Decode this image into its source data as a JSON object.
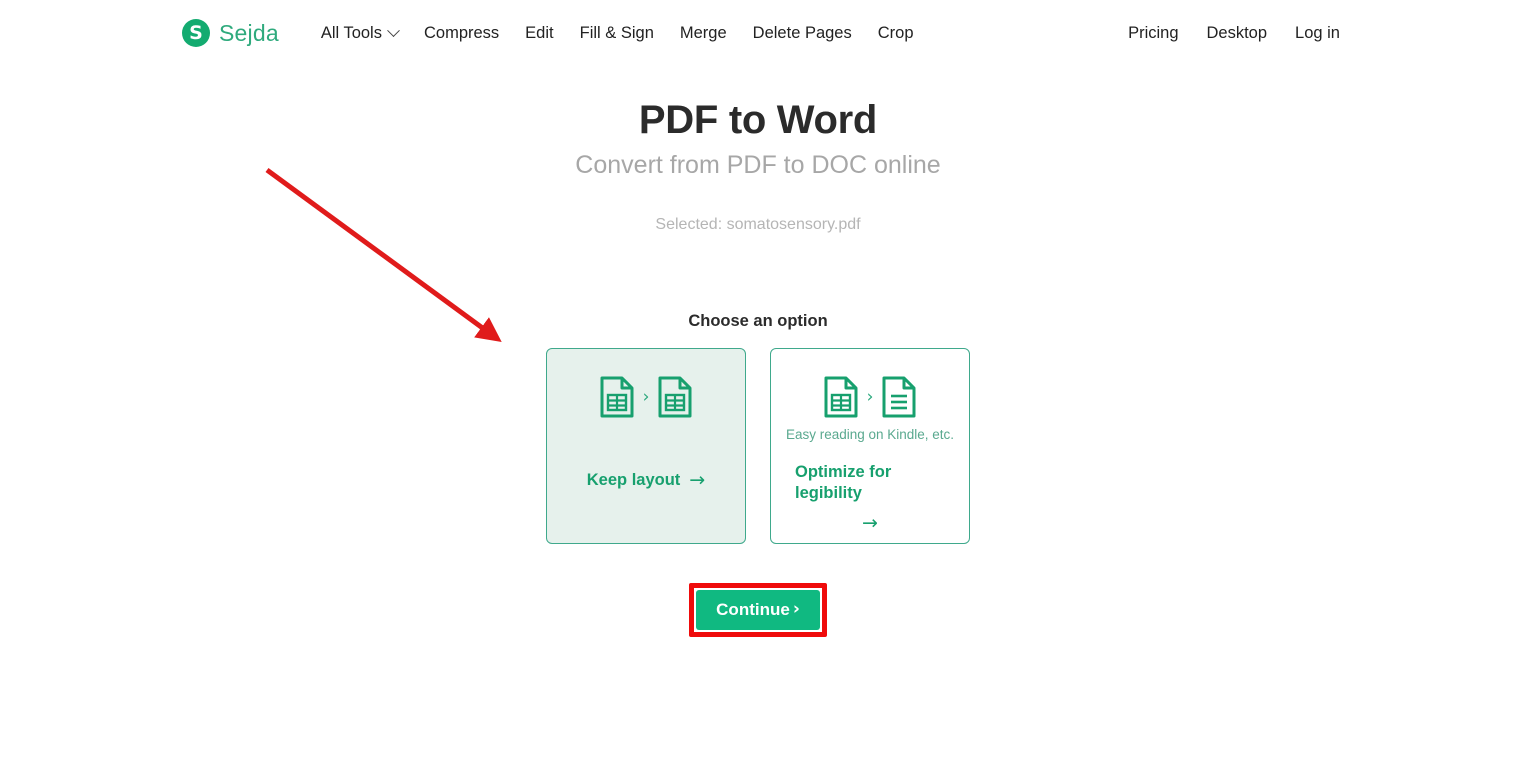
{
  "navbar": {
    "brand": {
      "mark": "S",
      "name": "Sejda"
    },
    "left_links": [
      {
        "label": "All Tools",
        "has_caret": true,
        "icon": "chevron-down-icon"
      },
      {
        "label": "Compress",
        "has_caret": false
      },
      {
        "label": "Edit",
        "has_caret": false
      },
      {
        "label": "Fill & Sign",
        "has_caret": false
      },
      {
        "label": "Merge",
        "has_caret": false
      },
      {
        "label": "Delete Pages",
        "has_caret": false
      },
      {
        "label": "Crop",
        "has_caret": false
      }
    ],
    "right_links": [
      {
        "label": "Pricing"
      },
      {
        "label": "Desktop"
      },
      {
        "label": "Log in"
      }
    ]
  },
  "main": {
    "title": "PDF to Word",
    "subtitle": "Convert from PDF to DOC online",
    "selected_file": "Selected: somatosensory.pdf",
    "choose_label": "Choose an option"
  },
  "options": {
    "cards": [
      {
        "id": "keep-layout",
        "selected": true,
        "note": "",
        "action_label": "Keep layout",
        "arrow": "→",
        "icon_from": "spreadsheet-document-icon",
        "icon_to": "spreadsheet-document-icon",
        "separator": "›"
      },
      {
        "id": "optimize-for-legibility",
        "selected": false,
        "note": "Easy reading on Kindle, etc.",
        "action_label": "Optimize for legibility",
        "arrow": "→",
        "icon_from": "spreadsheet-document-icon",
        "icon_to": "text-document-icon",
        "separator": "›"
      }
    ]
  },
  "continue": {
    "label": "Continue",
    "chevron": "›"
  },
  "annotation": {
    "arrow_color": "#e01b1b",
    "highlight_color": "#ef0b0b"
  },
  "colors": {
    "brand_green": "#13ab70",
    "brand_text": "#2faa7d",
    "accent_green": "#17a06e",
    "card_border": "#3fa98c",
    "card_selected_bg": "#e6f1ec",
    "button_green": "#10b981",
    "title": "#2b2b2b",
    "subtitle": "#a7a7a7",
    "muted": "#b5b5b5"
  }
}
